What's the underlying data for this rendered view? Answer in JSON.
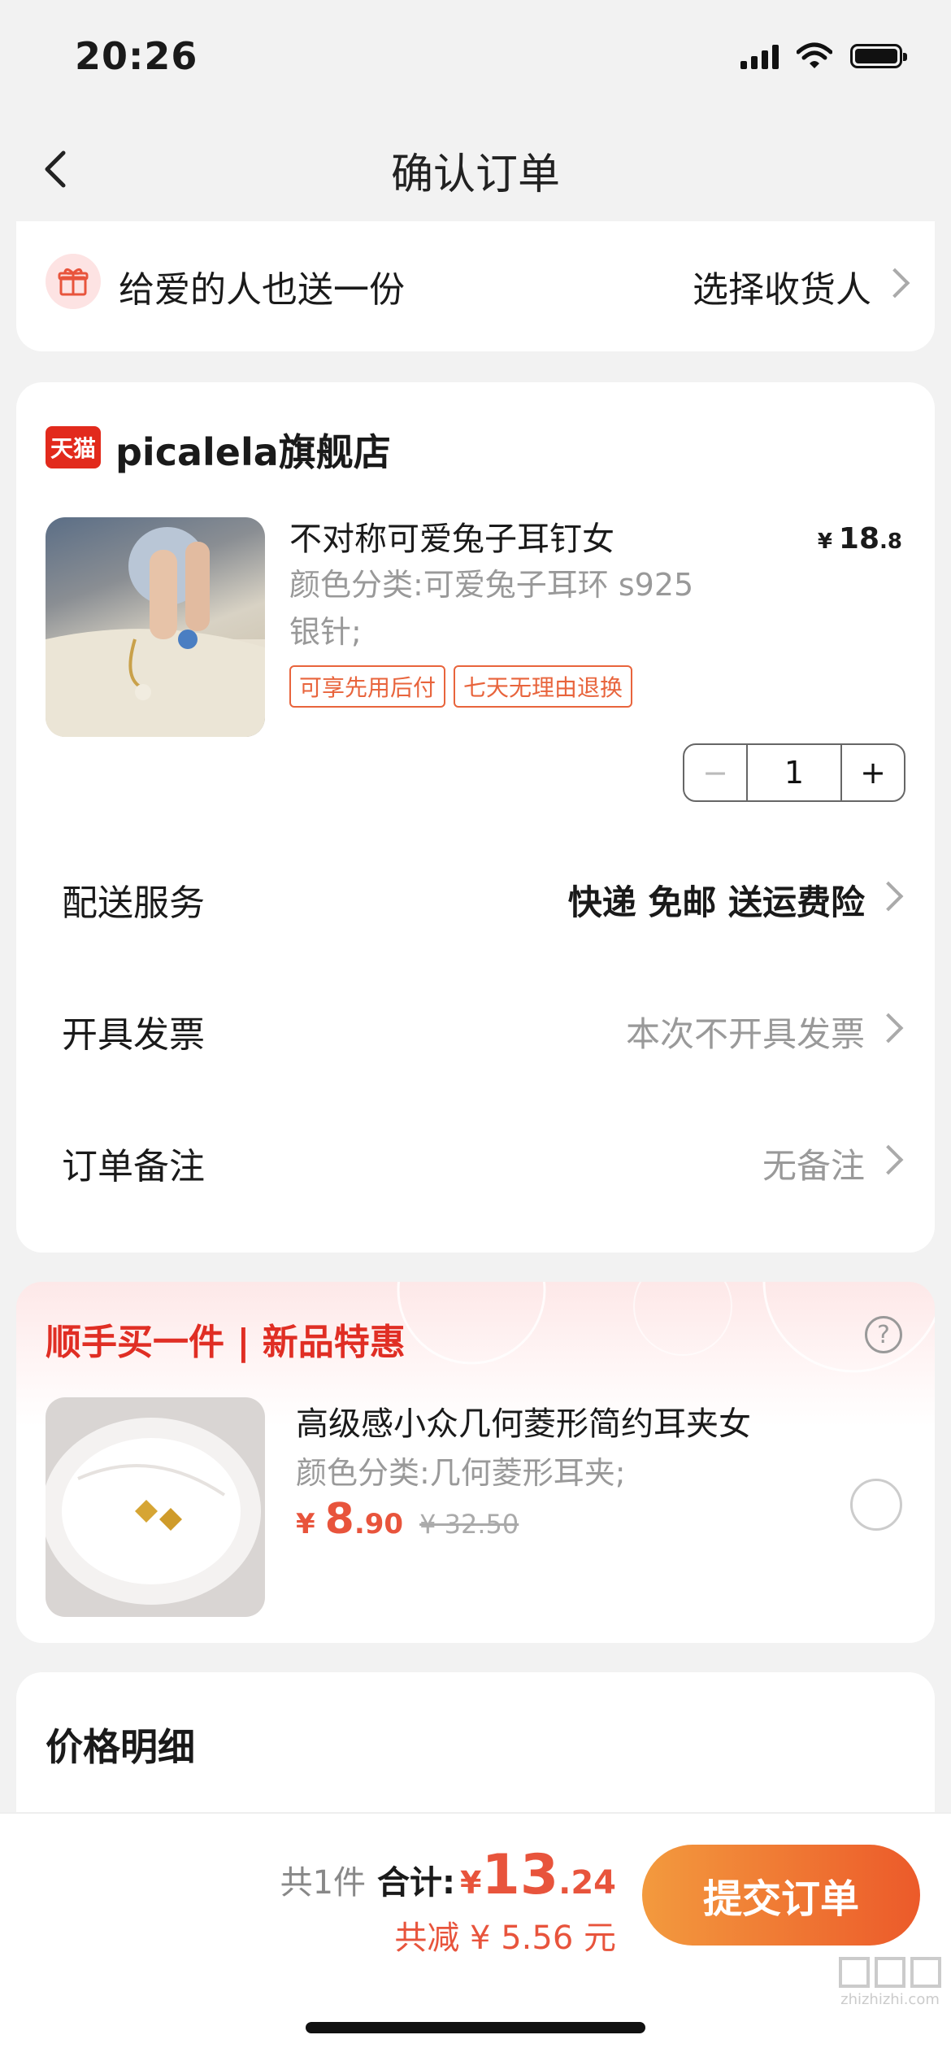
{
  "status": {
    "time": "20:26"
  },
  "nav": {
    "title": "确认订单"
  },
  "gift": {
    "label": "给爱的人也送一份",
    "action": "选择收货人"
  },
  "store": {
    "badge": "天猫",
    "name": "picalela旗舰店",
    "product": {
      "title": "不对称可爱兔子耳钉女",
      "variant_line1": "颜色分类:可爱兔子耳环 s925",
      "variant_line2": "银针;",
      "price_symbol": "¥",
      "price_int": "18",
      "price_dec": ".8",
      "tags": [
        "可享先用后付",
        "七天无理由退换"
      ],
      "qty": "1"
    },
    "rows": [
      {
        "label": "配送服务",
        "value": "快递 免邮 送运费险"
      },
      {
        "label": "开具发票",
        "value": "本次不开具发票"
      },
      {
        "label": "订单备注",
        "value": "无备注"
      }
    ]
  },
  "addon": {
    "title": "顺手买一件 | 新品特惠",
    "help_icon": "question-circle-icon",
    "product": {
      "title": "高级感小众几何菱形简约耳夹女",
      "variant": "颜色分类:几何菱形耳夹;",
      "price_symbol": "¥",
      "price_int": "8",
      "price_dec": ".90",
      "original_price": "¥ 32.50"
    }
  },
  "price_detail": {
    "title": "价格明细"
  },
  "footer": {
    "count": "共1件",
    "total_label": "合计:",
    "total_symbol": "¥",
    "total_int": "13",
    "total_dec": ".24",
    "saved": "共减 ¥ 5.56 元",
    "submit": "提交订单"
  },
  "watermark": {
    "text": "zhizhizhi.com"
  },
  "colors": {
    "accent": "#e8643c",
    "red": "#e02e24",
    "submit_start": "#f39a3e",
    "submit_end": "#ec5a2a"
  }
}
